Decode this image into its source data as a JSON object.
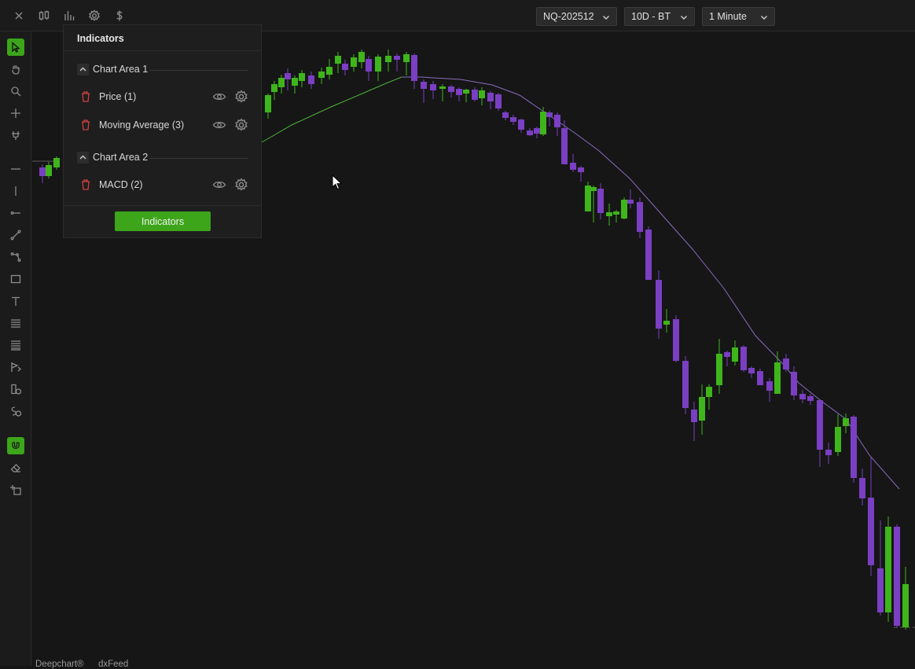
{
  "topbar": {
    "icons": [
      "close-icon",
      "candlestick-icon",
      "bar-chart-icon",
      "gear-icon",
      "dollar-icon"
    ],
    "symbol": "NQ-202512",
    "range": "10D - BT",
    "interval": "1 Minute"
  },
  "toolbar": {
    "tools": [
      "cursor-pointer-icon",
      "hand-pan-icon",
      "zoom-icon",
      "crosshair-icon",
      "magnet-cursor-icon",
      "horizontal-line-icon",
      "vertical-line-icon",
      "ray-icon",
      "trend-line-icon",
      "polyline-icon",
      "rectangle-icon",
      "text-icon",
      "lines-icon",
      "lines-extended-icon",
      "order-flag-icon",
      "dollar-tag-icon",
      "dollar-lasso-icon",
      "magnet-icon",
      "eraser-icon",
      "object-manager-icon"
    ]
  },
  "indicators_panel": {
    "title": "Indicators",
    "areas": [
      {
        "label": "Chart Area 1",
        "items": [
          {
            "name": "Price (1)"
          },
          {
            "name": "Moving Average (3)"
          }
        ]
      },
      {
        "label": "Chart Area 2",
        "items": [
          {
            "name": "MACD (2)"
          }
        ]
      }
    ],
    "button": "Indicators"
  },
  "colors": {
    "bull": "#3fb51c",
    "bear": "#7a3fc2",
    "ma_green": "#4cb33a",
    "ma_purple": "#8a6bbf",
    "accent": "#3da51a",
    "delete": "#d04040"
  },
  "footer": {
    "brand": "Deepchart®",
    "feed": "dxFeed"
  }
}
